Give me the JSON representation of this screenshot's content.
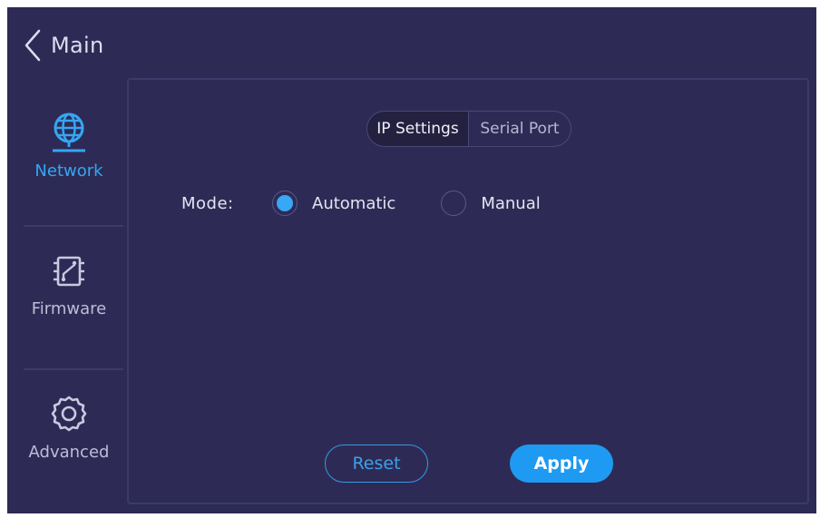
{
  "header": {
    "title": "Main",
    "back_icon": "chevron-left-icon"
  },
  "sidebar": {
    "items": [
      {
        "label": "Network",
        "icon": "globe-network-icon",
        "active": true
      },
      {
        "label": "Firmware",
        "icon": "firmware-board-icon",
        "active": false
      },
      {
        "label": "Advanced",
        "icon": "gear-icon",
        "active": false
      }
    ]
  },
  "tabs": [
    {
      "label": "IP Settings",
      "active": true
    },
    {
      "label": "Serial Port",
      "active": false
    }
  ],
  "mode": {
    "label": "Mode:",
    "options": [
      {
        "label": "Automatic",
        "selected": true
      },
      {
        "label": "Manual",
        "selected": false
      }
    ]
  },
  "buttons": {
    "reset": "Reset",
    "apply": "Apply"
  },
  "colors": {
    "background": "#2d2b55",
    "accent": "#1f9af2",
    "active_label": "#35a6f3",
    "text": "#e4e4f2"
  }
}
